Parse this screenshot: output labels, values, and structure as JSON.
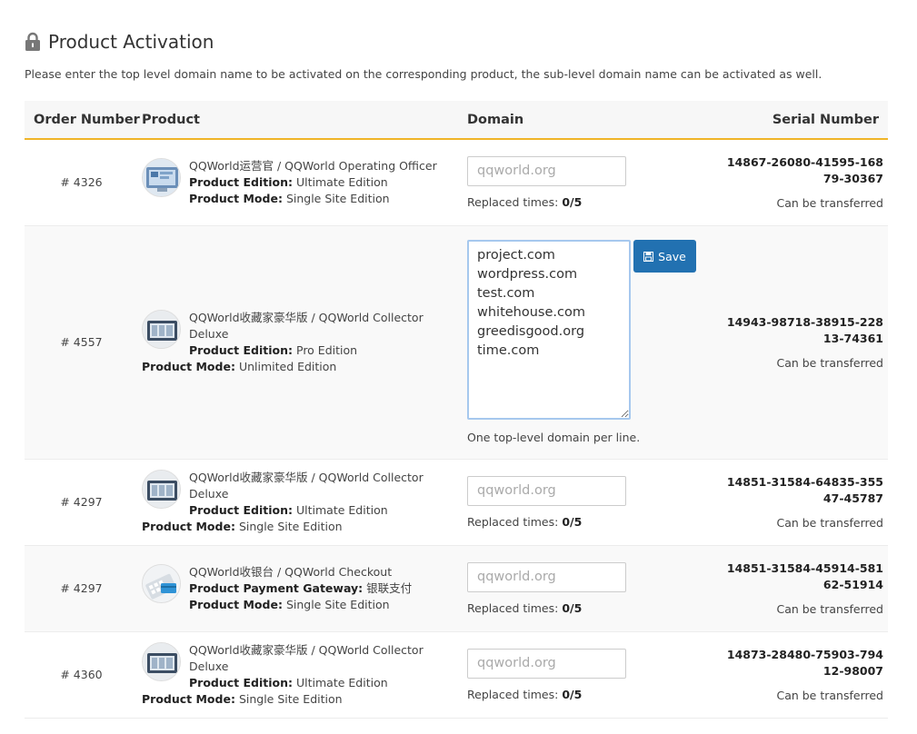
{
  "page": {
    "title": "Product Activation",
    "intro": "Please enter the top level domain name to be activated on the corresponding product, the sub-level domain name can be activated as well."
  },
  "table": {
    "headers": {
      "order": "Order Number",
      "product": "Product",
      "domain": "Domain",
      "serial": "Serial Number"
    },
    "labels": {
      "edition": "Product Edition:",
      "mode": "Product Mode:",
      "gateway": "Product Payment Gateway:",
      "replaced": "Replaced times:",
      "transfer": "Can be transferred",
      "save": "Save",
      "hint": "One top-level domain per line."
    },
    "rows": [
      {
        "order": "# 4326",
        "name": "QQWorld运营官 / QQWorld Operating Officer",
        "edition": "Ultimate Edition",
        "mode": "Single Site Edition",
        "placeholder": "qqworld.org",
        "replaced": "0/5",
        "serial": "14867-26080-41595-16879-30367"
      },
      {
        "order": "# 4557",
        "name_line1": "QQWorld收藏家豪华版 / QQWorld Collector",
        "name_line2": "Deluxe",
        "edition": "Pro Edition",
        "mode": "Unlimited Edition",
        "domains": "project.com\nwordpress.com\ntest.com\nwhitehouse.com\ngreedisgood.org\ntime.com",
        "serial": "14943-98718-38915-22813-74361"
      },
      {
        "order": "# 4297",
        "name_line1": "QQWorld收藏家豪华版 / QQWorld Collector",
        "name_line2": "Deluxe",
        "edition": "Ultimate Edition",
        "mode": "Single Site Edition",
        "placeholder": "qqworld.org",
        "replaced": "0/5",
        "serial": "14851-31584-64835-35547-45787"
      },
      {
        "order": "# 4297",
        "name": "QQWorld收银台 / QQWorld Checkout",
        "gateway": "银联支付",
        "mode": "Single Site Edition",
        "placeholder": "qqworld.org",
        "replaced": "0/5",
        "serial": "14851-31584-45914-58162-51914"
      },
      {
        "order": "# 4360",
        "name_line1": "QQWorld收藏家豪华版 / QQWorld Collector",
        "name_line2": "Deluxe",
        "edition": "Ultimate Edition",
        "mode": "Single Site Edition",
        "placeholder": "qqworld.org",
        "replaced": "0/5",
        "serial": "14873-28480-75903-79412-98007"
      }
    ]
  },
  "icons": {
    "title": "lock-icon",
    "save": "save-icon",
    "product_officer": "officer-thumbnail",
    "product_collector": "collector-thumbnail",
    "product_checkout": "checkout-thumbnail"
  },
  "colors": {
    "header_border": "#f0b528",
    "save_button": "#2271b1",
    "textarea_focus": "#a6c8ee"
  }
}
